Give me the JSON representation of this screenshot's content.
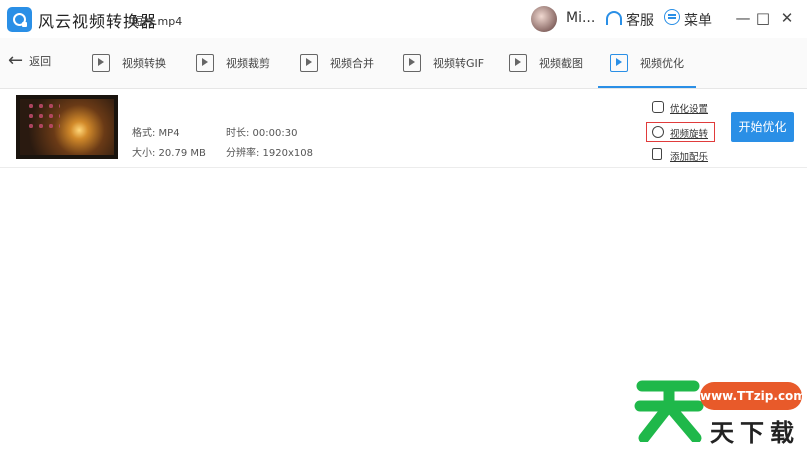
{
  "app": {
    "title": "风云视频转换器",
    "username": "Mi...",
    "support_label": "客服",
    "menu_label": "菜单"
  },
  "window_controls": {
    "minimize": "—",
    "maximize": "□",
    "close": "✕"
  },
  "toolbar": {
    "back_label": "返回",
    "tools": [
      {
        "label": "视频转换",
        "icon": "video-convert-icon"
      },
      {
        "label": "视频裁剪",
        "icon": "video-crop-icon"
      },
      {
        "label": "视频合并",
        "icon": "video-merge-icon"
      },
      {
        "label": "视频转GIF",
        "icon": "video-to-gif-icon"
      },
      {
        "label": "视频截图",
        "icon": "screenshot-icon"
      },
      {
        "label": "视频优化",
        "icon": "optimize-icon",
        "active": true
      }
    ]
  },
  "file": {
    "name": "短片.mp4",
    "format": "格式: MP4",
    "duration": "时长: 00:00:30",
    "size": "大小: 20.79 MB",
    "resolution": "分辨率: 1920x108"
  },
  "actions": {
    "optimize_settings": "优化设置",
    "rotate": "视频旋转",
    "add_music": "添加配乐",
    "start": "开始优化"
  },
  "watermark": {
    "url": "www.TTzip.com",
    "brand": "天下载",
    "mark": "天"
  },
  "colors": {
    "accent": "#2a8fe6",
    "highlight": "#e03b3b",
    "watermark_green": "#1fb84a",
    "watermark_orange": "#e85a2a"
  }
}
